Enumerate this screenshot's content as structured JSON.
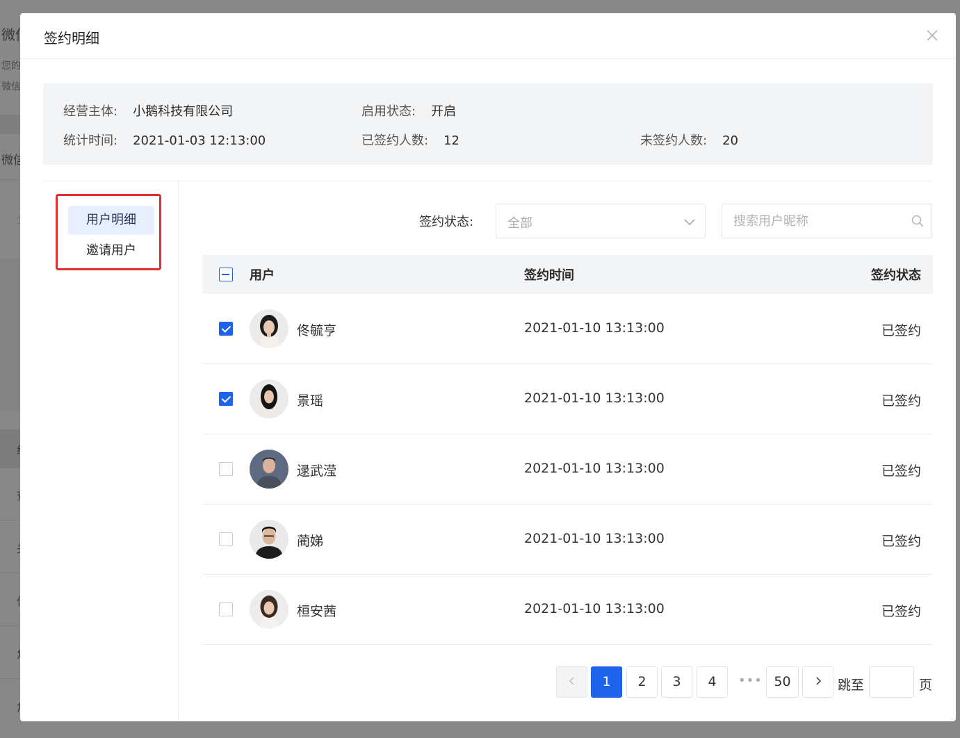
{
  "background": {
    "strips": [
      "微信",
      "您的",
      "微信",
      "微信",
      "全",
      "约",
      "查",
      "关",
      "信",
      "角",
      "角"
    ]
  },
  "modal": {
    "title": "签约明细"
  },
  "info": {
    "entity_label": "经营主体:",
    "entity_value": "小鹅科技有限公司",
    "status_label": "启用状态:",
    "status_value": "开启",
    "time_label": "统计时间:",
    "time_value": "2021-01-03 12:13:00",
    "signed_label": "已签约人数:",
    "signed_value": "12",
    "unsigned_label": "未签约人数:",
    "unsigned_value": "20"
  },
  "side_menu": {
    "items": [
      {
        "label": "用户明细",
        "active": true
      },
      {
        "label": "邀请用户",
        "active": false
      }
    ]
  },
  "filter": {
    "status_label": "签约状态:",
    "status_selected": "全部",
    "search_placeholder": "搜索用户昵称"
  },
  "table": {
    "columns": [
      "用户",
      "签约时间",
      "签约状态"
    ],
    "rows": [
      {
        "name": "佟毓亨",
        "time": "2021-01-10 13:13:00",
        "status": "已签约",
        "checked": true,
        "avatar": "female-1"
      },
      {
        "name": "景瑶",
        "time": "2021-01-10 13:13:00",
        "status": "已签约",
        "checked": true,
        "avatar": "female-2"
      },
      {
        "name": "逯武滢",
        "time": "2021-01-10 13:13:00",
        "status": "已签约",
        "checked": false,
        "avatar": "male-1"
      },
      {
        "name": "蔺娣",
        "time": "2021-01-10 13:13:00",
        "status": "已签约",
        "checked": false,
        "avatar": "male-2"
      },
      {
        "name": "桓安茜",
        "time": "2021-01-10 13:13:00",
        "status": "已签约",
        "checked": false,
        "avatar": "female-3"
      }
    ]
  },
  "pagination": {
    "pages": [
      "1",
      "2",
      "3",
      "4"
    ],
    "ellipsis": "•••",
    "last_page": "50",
    "current": "1",
    "jump_label": "跳至",
    "page_suffix": "页"
  },
  "colors": {
    "accent": "#1e63e9",
    "highlight_border": "#e02d2d",
    "menu_active_bg": "#e8efff"
  }
}
